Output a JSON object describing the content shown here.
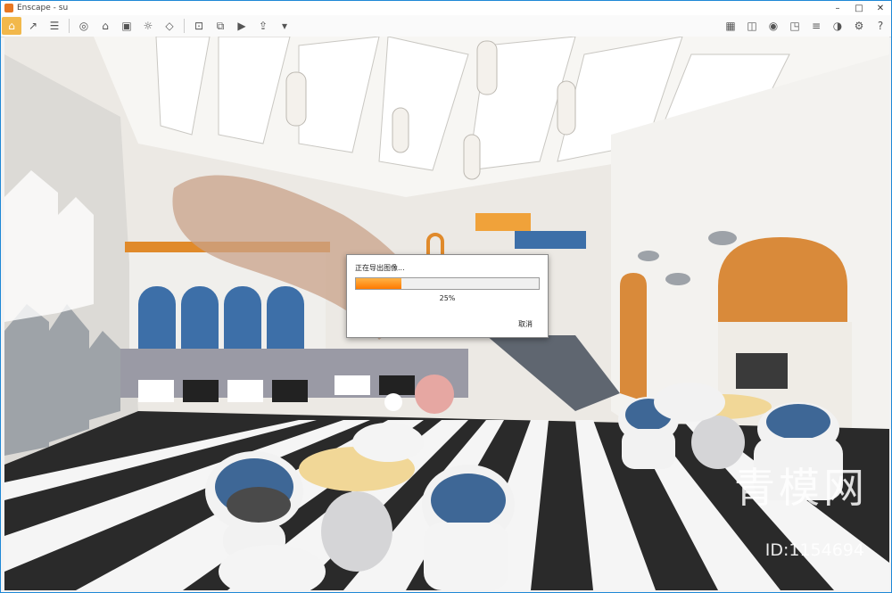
{
  "window": {
    "title": "Enscape - su"
  },
  "dialog": {
    "label": "正在导出图像...",
    "percent_text": "25%",
    "progress": 0.25,
    "cancel_label": "取消"
  },
  "watermark": {
    "brand_cn": "青模网",
    "id_text": "ID:1154694"
  },
  "colors": {
    "accent": "#f2b84b",
    "progress": "#ff7a00",
    "frame": "#1e88d6"
  }
}
